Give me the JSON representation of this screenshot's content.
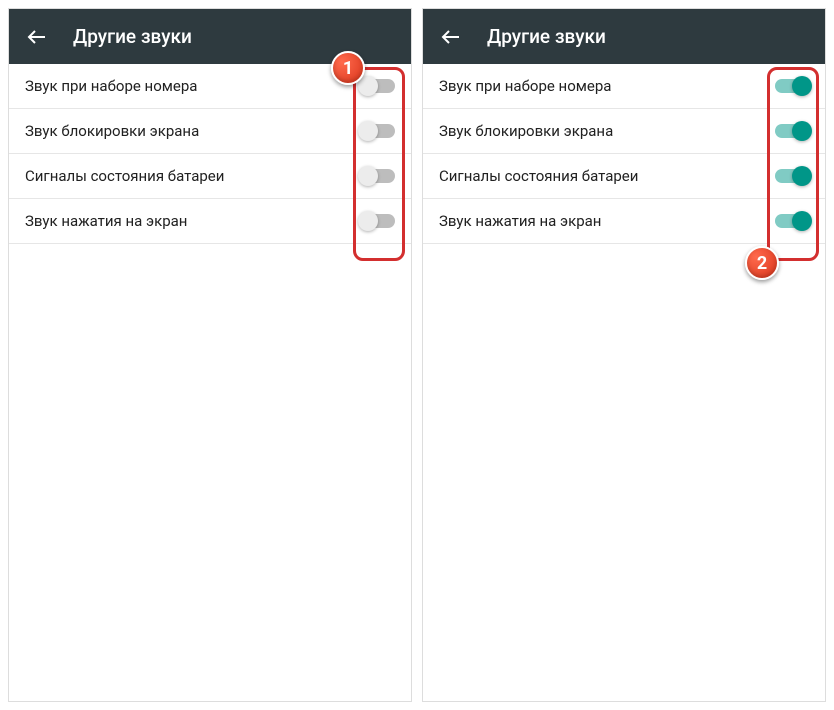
{
  "app_bar": {
    "title": "Другие звуки"
  },
  "settings": [
    {
      "label": "Звук при наборе номера"
    },
    {
      "label": "Звук блокировки экрана"
    },
    {
      "label": "Сигналы состояния батареи"
    },
    {
      "label": "Звук нажатия на экран"
    }
  ],
  "callouts": {
    "one": "1",
    "two": "2"
  }
}
